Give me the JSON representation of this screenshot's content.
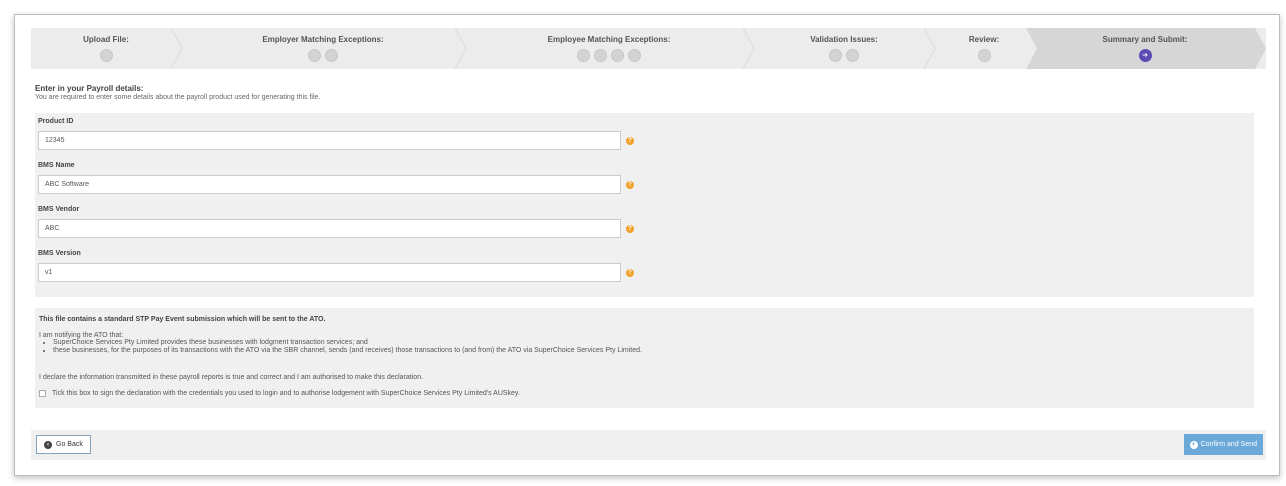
{
  "stepper": {
    "steps": [
      {
        "label": "Upload File:",
        "icons": [
          "step-icon"
        ]
      },
      {
        "label": "Employer Matching Exceptions:",
        "icons": [
          "step-icon",
          "step-icon"
        ]
      },
      {
        "label": "Employee Matching Exceptions:",
        "icons": [
          "step-icon",
          "step-icon",
          "step-icon",
          "step-icon"
        ]
      },
      {
        "label": "Validation Issues:",
        "icons": [
          "step-icon",
          "step-icon"
        ]
      },
      {
        "label": "Review:",
        "icons": [
          "step-icon"
        ]
      },
      {
        "label": "Summary and Submit:",
        "icons": [
          "arrow-right-icon"
        ],
        "active": true
      }
    ],
    "active_color": "#5b4cb3"
  },
  "intro": {
    "title": "Enter in your Payroll details:",
    "subtitle": "You are required to enter some details about the payroll product used for generating this file."
  },
  "form": {
    "fields": [
      {
        "label": "Product ID",
        "value": "12345"
      },
      {
        "label": "BMS Name",
        "value": "ABC Software"
      },
      {
        "label": "BMS Vendor",
        "value": "ABC"
      },
      {
        "label": "BMS Version",
        "value": "v1"
      }
    ],
    "help_color": "#f0a32b"
  },
  "declaration": {
    "title": "This file contains a standard STP Pay Event submission which will be sent to the ATO.",
    "intro": "I am notifying the ATO that:",
    "bullets": [
      "SuperChoice Services Pty Limited provides these businesses with lodgment transaction services; and",
      "these businesses, for the purposes of its transactions with the ATO via the SBR channel, sends (and receives) those transactions to (and from) the ATO via SuperChoice Services Pty Limited."
    ],
    "declare": "I declare the information transmitted in these payroll reports is true and correct and I am authorised to make this declaration.",
    "checkbox_label": "Tick this box to sign the declaration with the credentials you used to login and to authorise lodgement with SuperChoice Services Pty Limited's AUSkey.",
    "checked": false
  },
  "footer": {
    "back_label": "Go Back",
    "confirm_label": "Confirm and Send",
    "confirm_color": "#6aa9d8"
  }
}
